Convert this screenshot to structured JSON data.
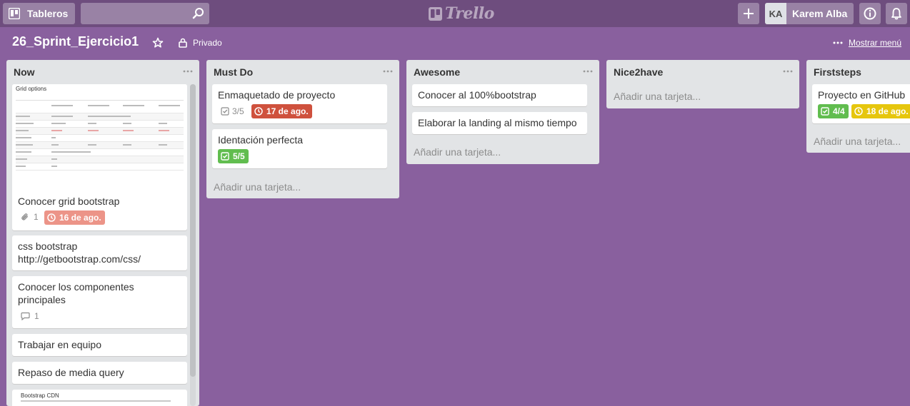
{
  "header": {
    "boards_label": "Tableros",
    "logo_text": "Trello",
    "user_initials": "KA",
    "user_name": "Karem Alba"
  },
  "board": {
    "title": "26_Sprint_Ejercicio1",
    "privacy": "Privado",
    "menu_label": "Mostrar menú"
  },
  "lists": [
    {
      "title": "Now",
      "cards": [
        {
          "title": "Conocer grid bootstrap",
          "attachments": "1",
          "due": "16 de ago.",
          "cover_title": "Grid options"
        },
        {
          "title": "css bootstrap http://getbootstrap.com/css/"
        },
        {
          "title": "Conocer los componentes principales",
          "comments": "1"
        },
        {
          "title": "Trabajar en equipo"
        },
        {
          "title": "Repaso de media query"
        },
        {
          "cover_title": "Bootstrap CDN"
        }
      ]
    },
    {
      "title": "Must Do",
      "cards": [
        {
          "title": "Enmaquetado de proyecto",
          "checklist": "3/5",
          "due": "17 de ago."
        },
        {
          "title": "Identación perfecta",
          "checklist": "5/5"
        }
      ],
      "add_label": "Añadir una tarjeta..."
    },
    {
      "title": "Awesome",
      "cards": [
        {
          "title": "Conocer al 100%bootstrap"
        },
        {
          "title": "Elaborar la landing al mismo tiempo"
        }
      ],
      "add_label": "Añadir una tarjeta..."
    },
    {
      "title": "Nice2have",
      "cards": [],
      "add_label": "Añadir una tarjeta..."
    },
    {
      "title": "Firststeps",
      "cards": [
        {
          "title": "Proyecto en GitHub",
          "checklist": "4/4",
          "due": "18 de ago."
        }
      ],
      "add_label": "Añadir una tarjeta..."
    }
  ],
  "colors": {
    "board_bg": "#89609e",
    "header_bg": "#6e4d7e",
    "due_overdue": "#cf513d",
    "due_past": "#ec9488",
    "complete": "#61bd4f",
    "due_soon": "#e6c60d"
  }
}
